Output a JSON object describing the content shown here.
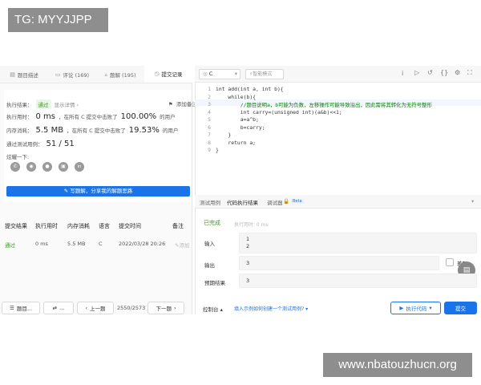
{
  "watermark_top": "TG: MYYJJPP",
  "watermark_bottom": "www.nbatouzhucn.org",
  "left_tabs": [
    {
      "label": "题目描述",
      "icon": "doc-icon"
    },
    {
      "label": "评论 (169)",
      "icon": "comment-icon"
    },
    {
      "label": "题解 (195)",
      "icon": "flask-icon"
    },
    {
      "label": "提交记录",
      "icon": "clock-icon"
    }
  ],
  "result": {
    "status_label": "执行结果：",
    "status": "通过",
    "detail_link": "显示详情 ›",
    "add_note": "添加备注",
    "time_label": "执行用时：",
    "time_value": "0 ms",
    "time_mid": "，在所有 C 提交中击败了",
    "time_pct": "100.00%",
    "time_suffix": "的用户",
    "mem_label": "内存消耗：",
    "mem_value": "5.5 MB",
    "mem_mid": "，在所有 C 提交中击败了",
    "mem_pct": "19.53%",
    "mem_suffix": "的用户",
    "cases_label": "通过测试用例：",
    "cases_value": "51 / 51",
    "share_label": "炫耀一下:",
    "share_icons": [
      "wechat-icon",
      "weibo-icon",
      "qq-icon",
      "douban-icon",
      "linkedin-icon"
    ],
    "write_btn": "写题解，分享我的解题思路"
  },
  "submissions": {
    "headers": [
      "提交结果",
      "执行用时",
      "内存消耗",
      "语言",
      "提交时间",
      "备注"
    ],
    "row": {
      "result": "通过",
      "time": "0 ms",
      "mem": "5.5 MB",
      "lang": "C",
      "date": "2022/03/28 20:26",
      "note": "添加"
    }
  },
  "bottom_nav": {
    "list": "题目...",
    "random": "...",
    "prev": "上一题",
    "progress": "2550/2573",
    "next": "下一题"
  },
  "editor": {
    "language": "C",
    "mode": "智能模式",
    "lines": [
      "int add(int a, int b){",
      "    while(b){",
      "        //题目说明a，b可能为负数，左移操作可能导致溢出，因此需将其转化为无符号整形",
      "        int carry=(unsigned int)(a&b)<<1;",
      "        a=a^b;",
      "        b=carry;",
      "    }",
      "    return a;",
      "}"
    ]
  },
  "console": {
    "tabs": [
      "测试用例",
      "代码执行结果",
      "调试器",
      "Beta"
    ],
    "status": "已完成",
    "exec_time": "执行用时: 0 ms",
    "input_label": "输入",
    "input_lines": [
      "1",
      "2"
    ],
    "output_label": "输出",
    "output_value": "3",
    "diff_label": "差别",
    "expected_label": "预期结果",
    "expected_value": "3",
    "console_label": "控制台",
    "hint": "填入示例如何创建一个测试用例?",
    "run_label": "执行代码",
    "submit_label": "提交"
  },
  "colors": {
    "accent": "#1a73e8",
    "pass": "#389e0d",
    "comment": "#008000"
  }
}
